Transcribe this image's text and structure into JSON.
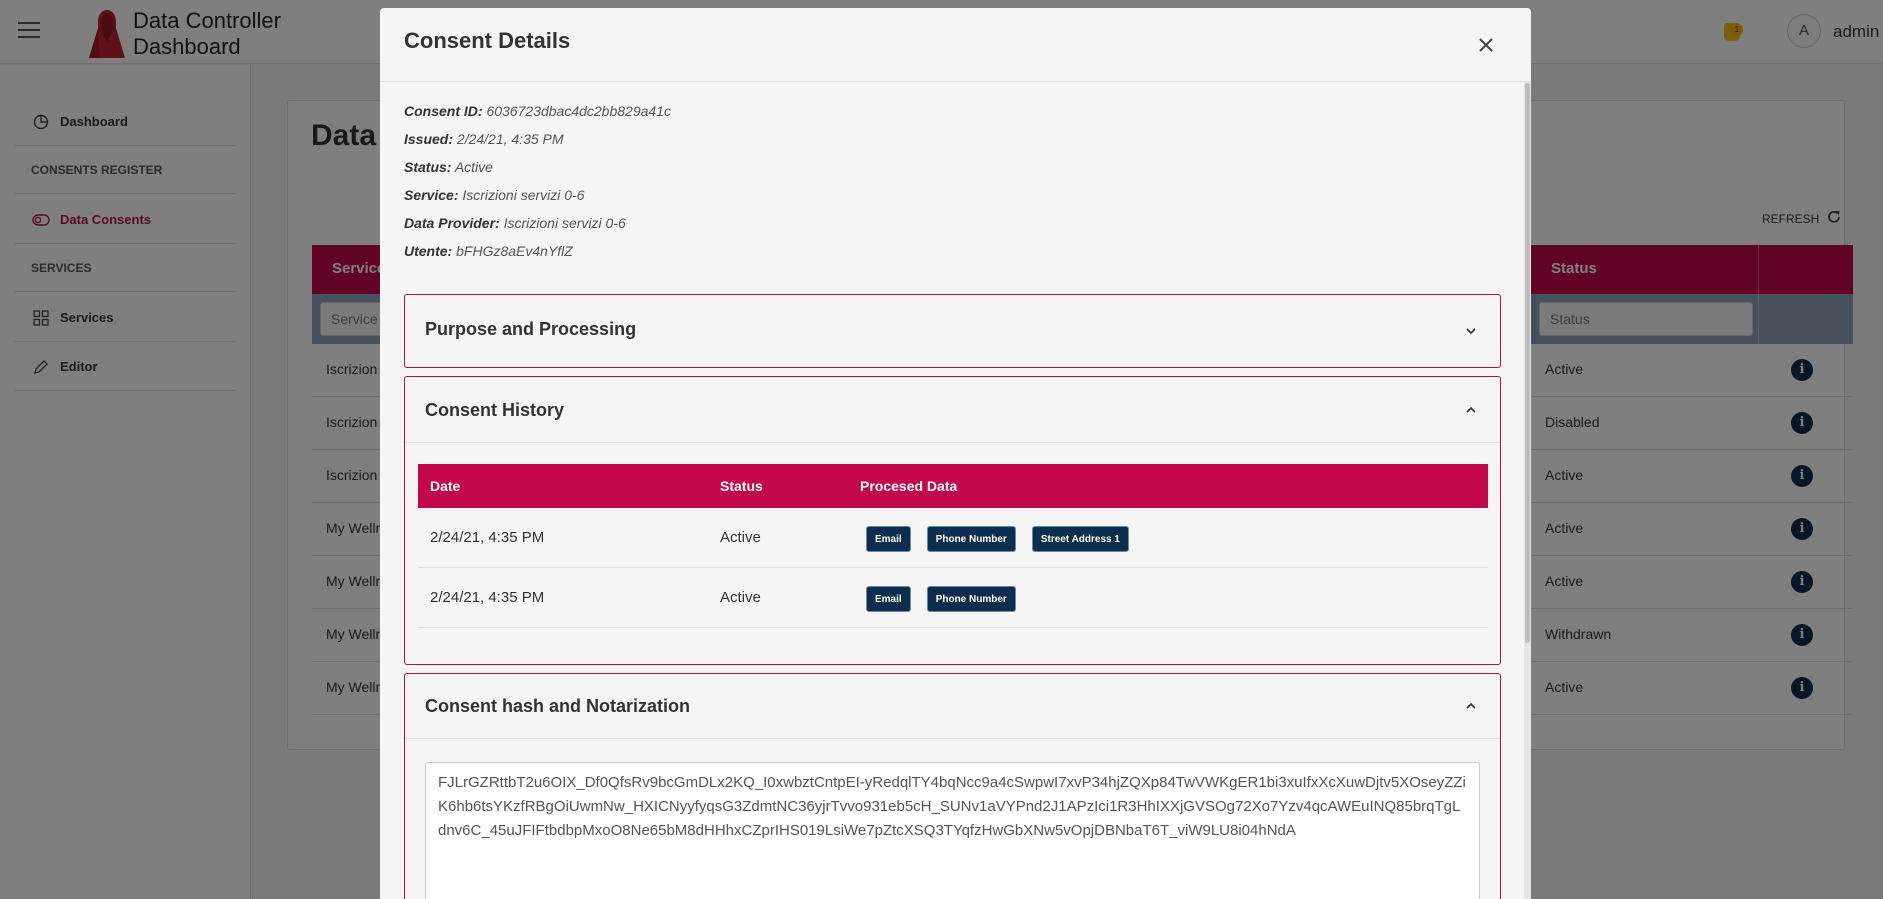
{
  "header": {
    "app_title_line1": "Data Controller",
    "app_title_line2": "Dashboard",
    "notification_count": "1",
    "avatar_initial": "A",
    "user_name": "admin"
  },
  "sidebar": {
    "items": [
      {
        "label": "Dashboard",
        "icon": "pie-chart-icon",
        "type": "link"
      },
      {
        "label": "CONSENTS REGISTER",
        "type": "section"
      },
      {
        "label": "Data Consents",
        "icon": "toggle-icon",
        "type": "link",
        "active": true
      },
      {
        "label": "SERVICES",
        "type": "section"
      },
      {
        "label": "Services",
        "icon": "grid-icon",
        "type": "link"
      },
      {
        "label": "Editor",
        "icon": "pencil-icon",
        "type": "link"
      }
    ]
  },
  "background": {
    "page_title": "Data",
    "refresh_label": "REFRESH",
    "columns": {
      "service": "Service",
      "status": "Status"
    },
    "filters": {
      "service_placeholder": "Service",
      "status_placeholder": "Status"
    },
    "rows": [
      {
        "service": "Iscrizion",
        "status": "Active"
      },
      {
        "service": "Iscrizion",
        "status": "Disabled"
      },
      {
        "service": "Iscrizion",
        "status": "Active"
      },
      {
        "service": "My Welln",
        "status": "Active"
      },
      {
        "service": "My Welln",
        "status": "Active"
      },
      {
        "service": "My Welln",
        "status": "Withdrawn"
      },
      {
        "service": "My Welln",
        "status": "Active"
      }
    ]
  },
  "modal": {
    "title": "Consent Details",
    "meta": {
      "consent_id_label": "Consent ID:",
      "consent_id": "6036723dbac4dc2bb829a41c",
      "issued_label": "Issued:",
      "issued": "2/24/21, 4:35 PM",
      "status_label": "Status:",
      "status": "Active",
      "service_label": "Service:",
      "service": "Iscrizioni servizi 0-6",
      "provider_label": "Data Provider:",
      "provider": "Iscrizioni servizi 0-6",
      "utente_label": "Utente:",
      "utente": "bFHGz8aEv4nYflZ"
    },
    "purpose_panel": {
      "title": "Purpose and Processing",
      "expanded": false
    },
    "history_panel": {
      "title": "Consent History",
      "expanded": true,
      "columns": {
        "date": "Date",
        "status": "Status",
        "data": "Procesed Data"
      },
      "rows": [
        {
          "date": "2/24/21, 4:35 PM",
          "status": "Active",
          "tags": [
            "Email",
            "Phone Number",
            "Street Address 1"
          ]
        },
        {
          "date": "2/24/21, 4:35 PM",
          "status": "Active",
          "tags": [
            "Email",
            "Phone Number"
          ]
        }
      ]
    },
    "hash_panel": {
      "title": "Consent hash and Notarization",
      "expanded": true,
      "hash": "FJLrGZRttbT2u6OIX_Df0QfsRv9bcGmDLx2KQ_I0xwbztCntpEI-yRedqlTY4bqNcc9a4cSwpwI7xvP34hjZQXp84TwVWKgER1bi3xuIfxXcXuwDjtv5XOseyZZiK6hb6tsYKzfRBgOiUwmNw_HXICNyyfyqsG3ZdmtNC36yjrTvvo931eb5cH_SUNv1aVYPnd2J1APzIci1R3HhIXXjGVSOg72Xo7Yzv4qcAWEuINQ85brqTgLdnv6C_45uJFIFtbdbpMxoO8Ne65bM8dHHhxCZprIHS019LsiWe7pZtcXSQ3TYqfzHwGbXNw5vOpjDBNbaT6T_viW9LU8i04hNdA"
    }
  },
  "colors": {
    "accent": "#c2074a",
    "navy": "#0d2d4e",
    "filter_bar": "#8fa3b6"
  }
}
